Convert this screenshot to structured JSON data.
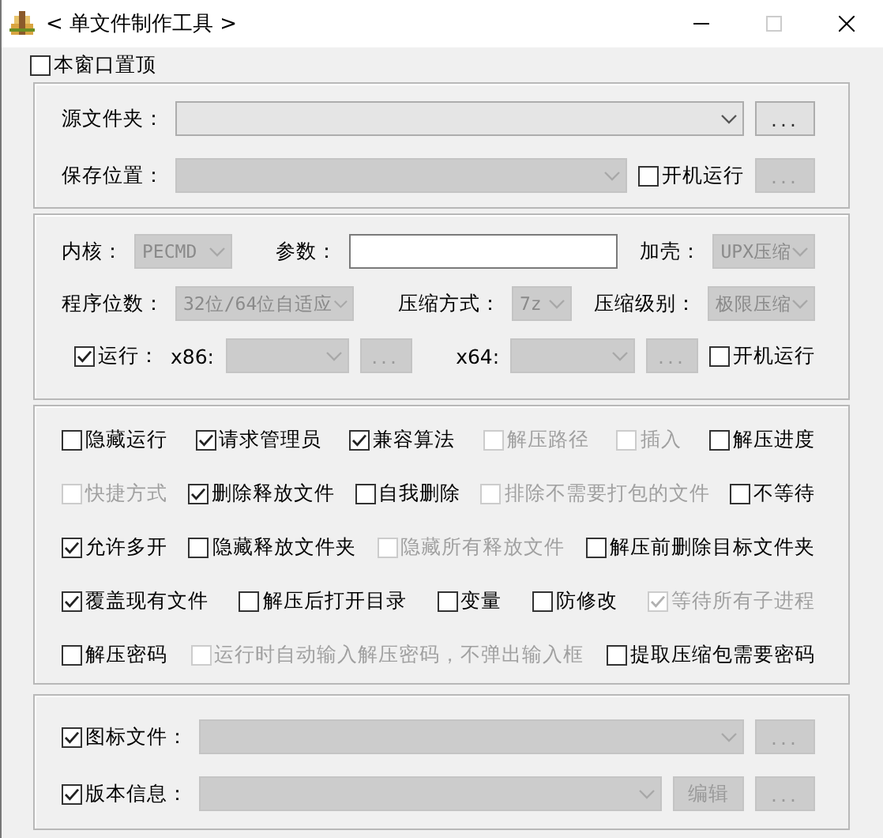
{
  "window": {
    "title": "< 单文件制作工具 >"
  },
  "stay_on_top": {
    "label": "本窗口置顶",
    "checked": false
  },
  "source": {
    "source_folder": {
      "label": "源文件夹：",
      "disabled": false,
      "button": {
        "label": "...",
        "disabled": false
      }
    },
    "save_location": {
      "label": "保存位置：",
      "disabled": true,
      "startup": {
        "label": "开机运行",
        "checked": false
      },
      "button": {
        "label": "...",
        "disabled": true
      }
    }
  },
  "settings": {
    "kernel": {
      "label": "内核：",
      "value": "PECMD",
      "disabled": true
    },
    "params": {
      "label": "参数："
    },
    "shell": {
      "label": "加壳：",
      "value": "UPX压缩",
      "disabled": true
    },
    "bits": {
      "label": "程序位数：",
      "value": "32位/64位自适应",
      "disabled": true
    },
    "compress_method": {
      "label": "压缩方式：",
      "value": "7z",
      "disabled": true
    },
    "compress_level": {
      "label": "压缩级别：",
      "value": "极限压缩",
      "disabled": true
    },
    "run": {
      "label": "运行：",
      "checked": true,
      "x86": {
        "label": "x86:",
        "disabled": true,
        "button": {
          "label": "...",
          "disabled": true
        }
      },
      "x64": {
        "label": "x64:",
        "disabled": true,
        "button": {
          "label": "...",
          "disabled": true
        }
      },
      "startup": {
        "label": "开机运行",
        "checked": false
      }
    }
  },
  "options": {
    "rows": [
      [
        {
          "label": "隐藏运行",
          "checked": false,
          "disabled": false
        },
        {
          "label": "请求管理员",
          "checked": true,
          "disabled": false
        },
        {
          "label": "兼容算法",
          "checked": true,
          "disabled": false
        },
        {
          "label": "解压路径",
          "checked": false,
          "disabled": true
        },
        {
          "label": "插入",
          "checked": false,
          "disabled": true
        },
        {
          "label": "解压进度",
          "checked": false,
          "disabled": false
        }
      ],
      [
        {
          "label": "快捷方式",
          "checked": false,
          "disabled": true
        },
        {
          "label": "删除释放文件",
          "checked": true,
          "disabled": false
        },
        {
          "label": "自我删除",
          "checked": false,
          "disabled": false
        },
        {
          "label": "排除不需要打包的文件",
          "checked": false,
          "disabled": true
        },
        {
          "label": "不等待",
          "checked": false,
          "disabled": false
        }
      ],
      [
        {
          "label": "允许多开",
          "checked": true,
          "disabled": false
        },
        {
          "label": "隐藏释放文件夹",
          "checked": false,
          "disabled": false
        },
        {
          "label": "隐藏所有释放文件",
          "checked": false,
          "disabled": true
        },
        {
          "label": "解压前删除目标文件夹",
          "checked": false,
          "disabled": false
        }
      ],
      [
        {
          "label": "覆盖现有文件",
          "checked": true,
          "disabled": false
        },
        {
          "label": "解压后打开目录",
          "checked": false,
          "disabled": false
        },
        {
          "label": "变量",
          "checked": false,
          "disabled": false
        },
        {
          "label": "防修改",
          "checked": false,
          "disabled": false
        },
        {
          "label": "等待所有子进程",
          "checked": true,
          "disabled": true
        }
      ],
      [
        {
          "label": "解压密码",
          "checked": false,
          "disabled": false
        },
        {
          "label": "运行时自动输入解压密码，不弹出输入框",
          "checked": false,
          "disabled": true
        },
        "",
        "",
        {
          "label": "提取压缩包需要密码",
          "checked": false,
          "disabled": false
        }
      ]
    ]
  },
  "resources": {
    "icon_file": {
      "label": "图标文件：",
      "checked": true,
      "combo_disabled": true,
      "button": {
        "label": "...",
        "disabled": true
      }
    },
    "version_info": {
      "label": "版本信息：",
      "checked": true,
      "combo_disabled": true,
      "edit_button": {
        "label": "编辑",
        "disabled": true
      },
      "button": {
        "label": "...",
        "disabled": true
      }
    }
  }
}
